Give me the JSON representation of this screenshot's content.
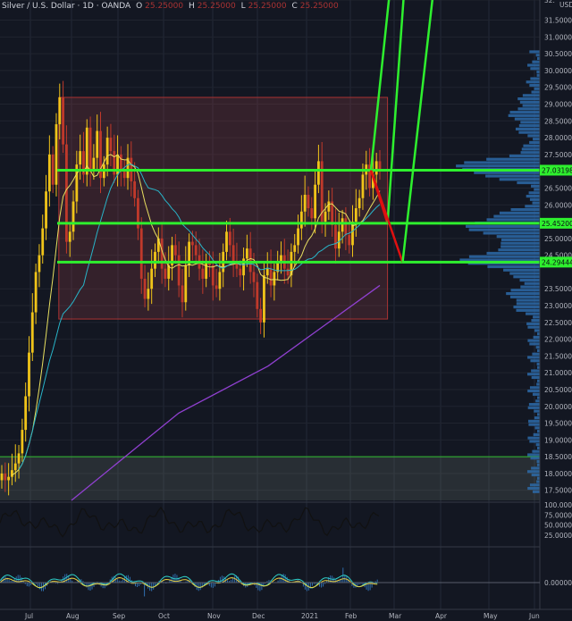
{
  "header": {
    "symbol": "Silver / U.S. Dollar",
    "interval": "1D",
    "exchange": "OANDA",
    "o_label": "O",
    "o_value": "25.25000",
    "h_label": "H",
    "h_value": "25.25000",
    "l_label": "L",
    "l_value": "25.25000",
    "c_label": "C",
    "c_value": "25.25000"
  },
  "price_axis": {
    "currency": "USD",
    "labels": [
      "32.",
      "31.50000",
      "31.00000",
      "30.50000",
      "30.00000",
      "29.50000",
      "29.00000",
      "28.50000",
      "28.00000",
      "27.50000",
      "26.50000",
      "26.00000",
      "25.00000",
      "24.50000",
      "23.50000",
      "23.00000",
      "22.50000",
      "22.00000",
      "21.50000",
      "21.00000",
      "20.50000",
      "20.00000",
      "19.50000",
      "19.00000",
      "18.50000",
      "18.00000",
      "17.50000"
    ]
  },
  "level_badges": [
    {
      "value": 27.03198,
      "text": "27.03198"
    },
    {
      "value": 25.452,
      "text": "25.45200"
    },
    {
      "value": 24.29444,
      "text": "24.29444"
    }
  ],
  "indicator1_axis": [
    "100.00000",
    "75.00000",
    "50.00000",
    "25.00000"
  ],
  "indicator2_axis": [
    "0.00000"
  ],
  "time_axis": [
    "Jul",
    "Aug",
    "Sep",
    "Oct",
    "Nov",
    "Dec",
    "2021",
    "Feb",
    "Mar",
    "Apr",
    "May",
    "Jun"
  ],
  "chart_data": {
    "type": "candlestick",
    "symbol": "XAGUSD",
    "x_range": [
      "Jul 2020",
      "Jun 2021"
    ],
    "y_range": [
      17.2,
      32.1
    ],
    "horizontal_levels": [
      27.03198,
      25.452,
      24.29444
    ],
    "range_box": {
      "from": "2020-07-23",
      "to": "2021-02-26",
      "low": 22.6,
      "high": 29.2
    },
    "support_zone": {
      "low": 17.2,
      "high": 18.5
    },
    "projected_paths": [
      {
        "points": [
          [
            "2021-02-15",
            27.03
          ],
          [
            "2021-02-26",
            25.45
          ],
          [
            "2021-03-10",
            33.0
          ]
        ]
      },
      {
        "points": [
          [
            "2021-02-15",
            27.03
          ],
          [
            "2021-03-08",
            24.29
          ],
          [
            "2021-03-30",
            33.0
          ]
        ]
      }
    ],
    "closes": [
      18.0,
      17.8,
      17.9,
      18.1,
      18.3,
      18.6,
      19.3,
      20.3,
      21.6,
      22.8,
      24.0,
      24.5,
      25.3,
      26.4,
      27.5,
      26.6,
      28.4,
      29.2,
      27.8,
      24.9,
      25.2,
      26.1,
      27.2,
      27.6,
      26.9,
      28.3,
      27.0,
      27.4,
      28.2,
      26.8,
      27.2,
      28.0,
      27.6,
      26.9,
      27.5,
      27.0,
      26.8,
      27.4,
      26.7,
      26.2,
      25.3,
      23.8,
      23.2,
      23.5,
      24.1,
      24.6,
      25.0,
      24.1,
      23.8,
      24.2,
      24.8,
      24.5,
      23.6,
      23.1,
      24.2,
      24.9,
      24.8,
      24.5,
      24.1,
      23.8,
      24.3,
      24.2,
      23.6,
      23.5,
      24.0,
      24.6,
      25.2,
      24.8,
      24.3,
      24.1,
      23.9,
      24.4,
      24.7,
      24.0,
      23.7,
      22.9,
      22.5,
      23.9,
      24.1,
      23.6,
      24.0,
      24.3,
      24.5,
      24.1,
      23.9,
      24.6,
      24.8,
      25.3,
      25.8,
      26.3,
      25.9,
      25.6,
      26.6,
      27.3,
      25.5,
      25.8,
      26.1,
      25.4,
      24.7,
      25.2,
      25.6,
      25.1,
      24.8,
      25.5,
      25.9,
      26.2,
      26.9,
      27.2,
      26.5,
      26.9,
      27.3,
      27.0
    ]
  }
}
